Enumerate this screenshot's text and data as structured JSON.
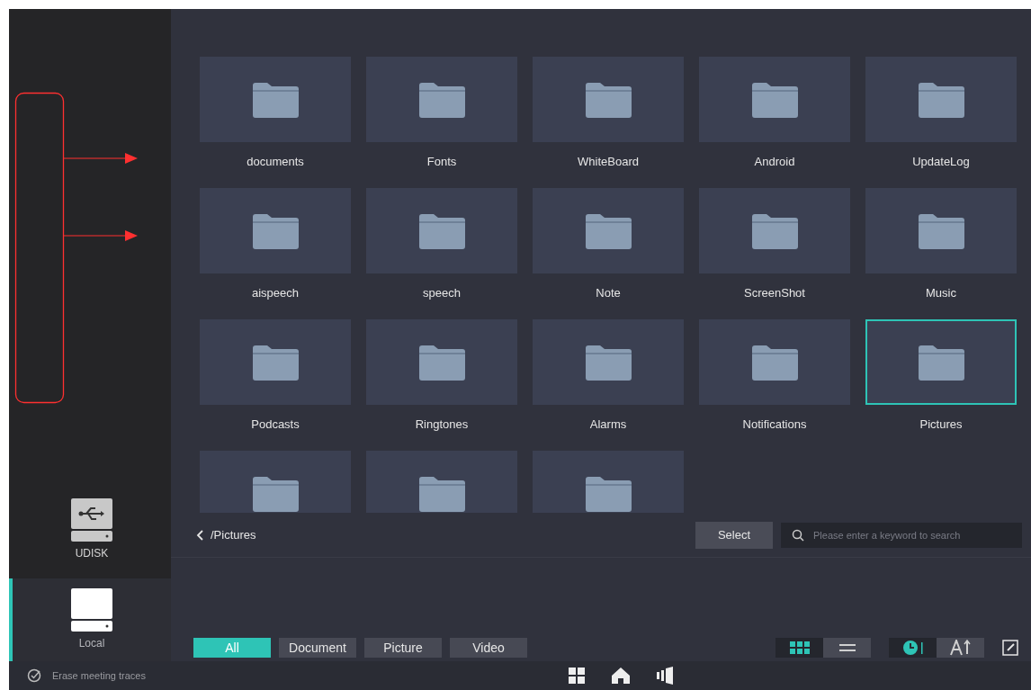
{
  "sidebar": {
    "devices": [
      {
        "kind": "usb",
        "label": "UDISK",
        "selected": false
      },
      {
        "kind": "local",
        "label": "Local",
        "selected": true
      }
    ]
  },
  "folders": [
    {
      "label": "documents",
      "selected": false
    },
    {
      "label": "Fonts",
      "selected": false
    },
    {
      "label": "WhiteBoard",
      "selected": false
    },
    {
      "label": "Android",
      "selected": false
    },
    {
      "label": "UpdateLog",
      "selected": false
    },
    {
      "label": "aispeech",
      "selected": false
    },
    {
      "label": "speech",
      "selected": false
    },
    {
      "label": "Note",
      "selected": false
    },
    {
      "label": "ScreenShot",
      "selected": false
    },
    {
      "label": "Music",
      "selected": false
    },
    {
      "label": "Podcasts",
      "selected": false
    },
    {
      "label": "Ringtones",
      "selected": false
    },
    {
      "label": "Alarms",
      "selected": false
    },
    {
      "label": "Notifications",
      "selected": false
    },
    {
      "label": "Pictures",
      "selected": true
    },
    {
      "selected": false
    },
    {
      "selected": false
    },
    {
      "selected": false
    }
  ],
  "path_bar": {
    "path": "/Pictures",
    "select_button": "Select",
    "search": {
      "placeholder": "Please enter a keyword to search"
    }
  },
  "filters": [
    {
      "label": "All",
      "selected": true
    },
    {
      "label": "Document",
      "selected": false
    },
    {
      "label": "Picture",
      "selected": false
    },
    {
      "label": "Video",
      "selected": false
    }
  ],
  "view_modes": [
    {
      "kind": "grid",
      "selected": true
    },
    {
      "kind": "list",
      "selected": false
    }
  ],
  "sort_modes": [
    {
      "kind": "time",
      "selected": true
    },
    {
      "kind": "name",
      "selected": false
    }
  ],
  "taskbar": {
    "erase_label": "Erase meeting traces"
  }
}
